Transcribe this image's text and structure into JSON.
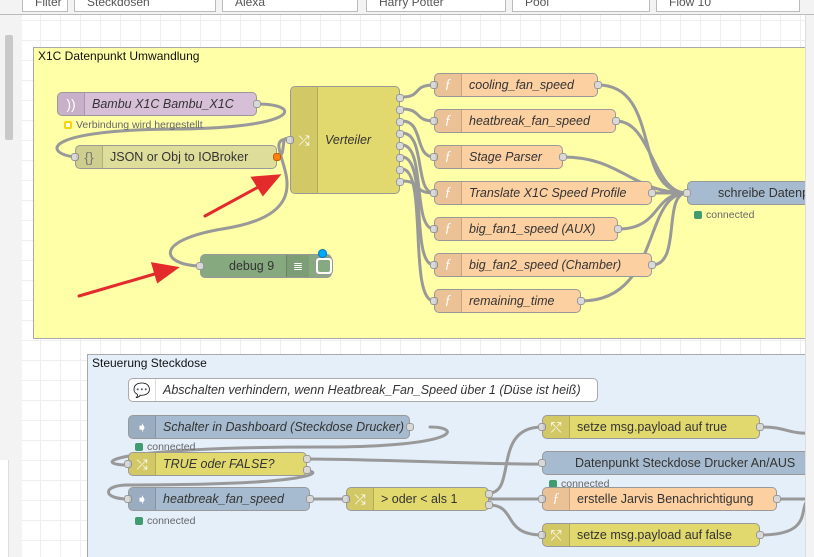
{
  "tabs": [
    "Filter",
    "Steckdosen",
    "Alexa",
    "Harry Potter",
    "Pool",
    "Flow 10"
  ],
  "groups": {
    "x1c": {
      "label": "X1C Datenpunkt Umwandlung"
    },
    "steckdose": {
      "label": "Steuerung Steckdose"
    }
  },
  "nodes": {
    "mqtt_in": {
      "label": "Bambu X1C Bambu_X1C",
      "status": "Verbindung wird hergestellt",
      "icon": "wifi-icon"
    },
    "json": {
      "label": "JSON or Obj to IOBroker",
      "icon": "json-icon"
    },
    "switch_verteiler": {
      "label": "Verteiler",
      "icon": "switch-icon"
    },
    "debug9": {
      "label": "debug 9",
      "icon": "debug-list-icon"
    },
    "fn_cooling": {
      "label": "cooling_fan_speed",
      "icon": "function-icon"
    },
    "fn_heatbreak": {
      "label": "heatbreak_fan_speed",
      "icon": "function-icon"
    },
    "fn_stage": {
      "label": "Stage Parser",
      "icon": "function-icon"
    },
    "fn_translate": {
      "label": "Translate X1C Speed Profile",
      "icon": "function-icon"
    },
    "fn_big1": {
      "label": "big_fan1_speed (AUX)",
      "icon": "function-icon"
    },
    "fn_big2": {
      "label": "big_fan2_speed (Chamber)",
      "icon": "function-icon"
    },
    "fn_remaining": {
      "label": "remaining_time",
      "icon": "function-icon"
    },
    "iob_out": {
      "label": "schreibe Datenpunkt",
      "status": "connected",
      "icon": "iobroker-icon"
    },
    "comment": {
      "label": "Abschalten verhindern, wenn Heatbreak_Fan_Speed über 1 (Düse ist heiß)",
      "icon": "comment-icon"
    },
    "iob_schalter": {
      "label": "Schalter in Dashboard (Steckdose Drucker)",
      "status": "connected",
      "icon": "iobroker-in-icon"
    },
    "sw_true_false": {
      "label": "TRUE oder FALSE?",
      "icon": "switch-icon"
    },
    "iob_heatbreak": {
      "label": "heatbreak_fan_speed",
      "status": "connected",
      "icon": "iobroker-in-icon"
    },
    "sw_oder": {
      "label": "> oder < als 1",
      "icon": "switch-icon"
    },
    "chg_true": {
      "label": "setze msg.payload auf true",
      "icon": "change-icon"
    },
    "iob_datenpunkt": {
      "label": "Datenpunkt Steckdose Drucker An/AUS",
      "status": "connected",
      "icon": "iobroker-icon"
    },
    "fn_jarvis": {
      "label": "erstelle Jarvis Benachrichtigung",
      "icon": "function-icon"
    },
    "chg_false": {
      "label": "setze msg.payload auf false",
      "icon": "change-icon"
    }
  },
  "colors": {
    "group_x1c_fill": "#ffffa8",
    "group_steckdose_fill": "#e4effa",
    "function": "#fdd0a2",
    "iobroker": "#a6bbcf",
    "switch": "#e2d96e",
    "debug": "#87a980",
    "mqtt": "#d8bfd8",
    "json": "#dede9a",
    "status_connected": "#3f9c6e",
    "status_connecting": "#f7d500",
    "changed_port": "#ff7f0e",
    "deploy_marker": "#00aaff",
    "arrow": "#e32b2b",
    "wire": "#999999"
  }
}
